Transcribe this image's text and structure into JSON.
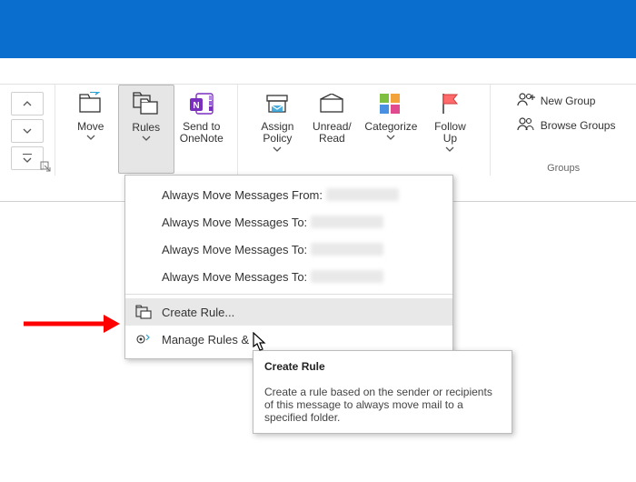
{
  "ribbon": {
    "move": {
      "label": "Move"
    },
    "rules": {
      "label": "Rules"
    },
    "onenote": {
      "label": "Send to\nOneNote"
    },
    "assign": {
      "label": "Assign\nPolicy"
    },
    "unread": {
      "label": "Unread/\nRead"
    },
    "categorize": {
      "label": "Categorize"
    },
    "followup": {
      "label": "Follow\nUp"
    },
    "groups_label": "Groups",
    "newgroup": "New Group",
    "browsegroups": "Browse Groups"
  },
  "rules_menu": {
    "from": "Always Move Messages From:",
    "to1": "Always Move Messages To:",
    "to2": "Always Move Messages To:",
    "to3": "Always Move Messages To:",
    "create": "Create Rule...",
    "manage": "Manage Rules &"
  },
  "tooltip": {
    "title": "Create Rule",
    "body": "Create a rule based on the sender or recipients of this message to always move mail to a specified folder."
  }
}
